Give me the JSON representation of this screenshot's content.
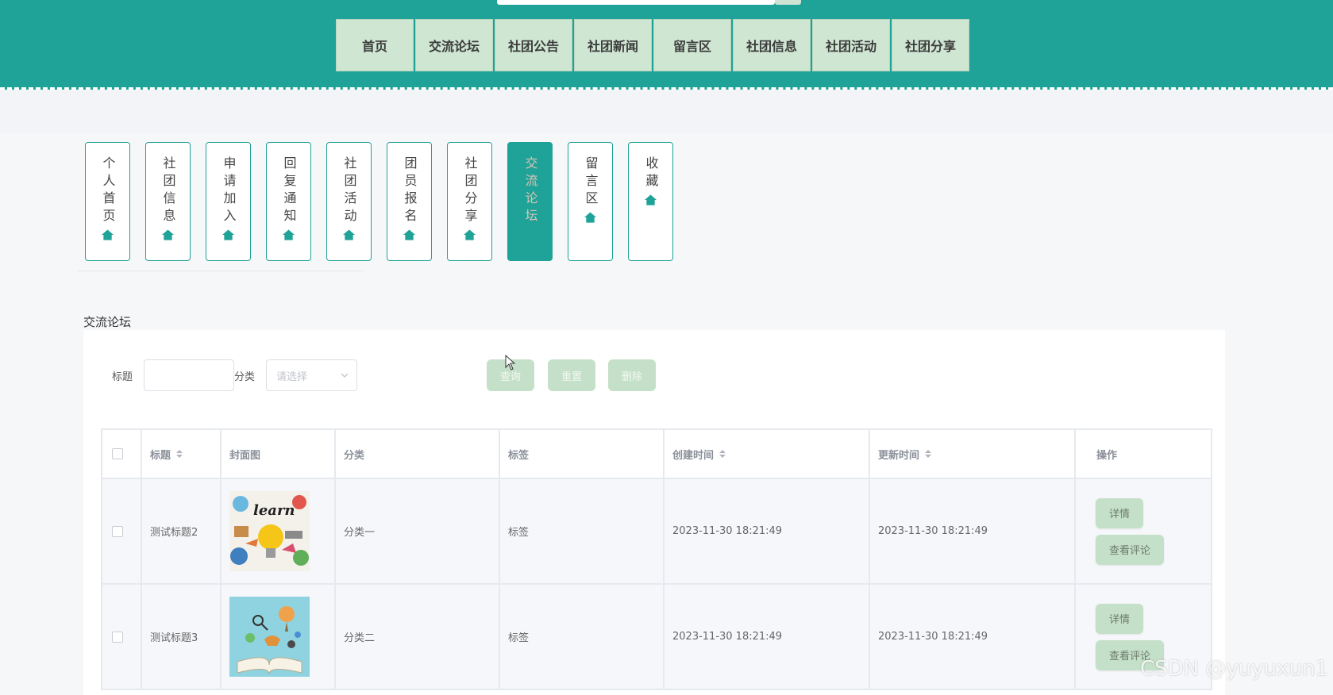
{
  "topnav": {
    "items": [
      "首页",
      "交流论坛",
      "社团公告",
      "社团新闻",
      "留言区",
      "社团信息",
      "社团活动",
      "社团分享"
    ]
  },
  "vtabs": {
    "items": [
      "个人首页",
      "社团信息",
      "申请加入",
      "回复通知",
      "社团活动",
      "团员报名",
      "社团分享",
      "交流论坛",
      "留言区",
      "收藏"
    ],
    "active_index": 7,
    "icon": "house-icon"
  },
  "section": {
    "title": "交流论坛"
  },
  "filters": {
    "title_label": "标题",
    "title_value": "",
    "category_label": "分类",
    "category_placeholder": "请选择",
    "query_button": "查询",
    "reset_button": "重置",
    "delete_button": "删除"
  },
  "table": {
    "headers": {
      "title": "标题",
      "cover": "封面图",
      "category": "分类",
      "tag": "标签",
      "created": "创建时间",
      "updated": "更新时间",
      "ops": "操作"
    },
    "rows": [
      {
        "title": "测试标题2",
        "category": "分类一",
        "tag": "标签",
        "created": "2023-11-30 18:21:49",
        "updated": "2023-11-30 18:21:49",
        "detail_button": "详情",
        "comments_button": "查看评论"
      },
      {
        "title": "测试标题3",
        "category": "分类二",
        "tag": "标签",
        "created": "2023-11-30 18:21:49",
        "updated": "2023-11-30 18:21:49",
        "detail_button": "详情",
        "comments_button": "查看评论"
      }
    ]
  },
  "watermark": "CSDN @yuyuxun1",
  "colors": {
    "primary": "#1fa297",
    "nav_bg": "#cfe6d2",
    "button_bg": "#c5e0c8"
  }
}
